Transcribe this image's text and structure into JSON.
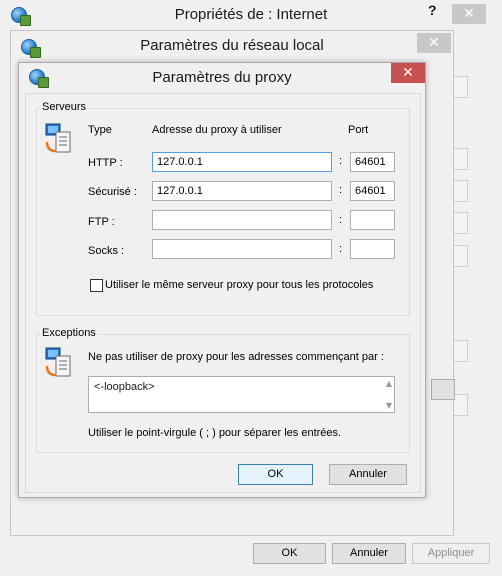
{
  "internet_props": {
    "title": "Propriétés de : Internet",
    "help_label": "?",
    "close_label": "✕",
    "ok_label": "OK",
    "cancel_label": "Annuler",
    "apply_label": "Appliquer"
  },
  "lan_settings": {
    "title": "Paramètres du réseau local",
    "close_label": "✕"
  },
  "proxy_settings": {
    "title": "Paramètres du proxy",
    "close_label": "✕",
    "servers": {
      "group_label": "Serveurs",
      "col_type": "Type",
      "col_address": "Adresse du proxy à utiliser",
      "col_port": "Port",
      "colon": ":",
      "rows": [
        {
          "type": "HTTP :",
          "address": "127.0.0.1",
          "port": "64601"
        },
        {
          "type": "Sécurisé :",
          "address": "127.0.0.1",
          "port": "64601"
        },
        {
          "type": "FTP :",
          "address": "",
          "port": ""
        },
        {
          "type": "Socks :",
          "address": "",
          "port": ""
        }
      ],
      "same_proxy_label": "Utiliser le même serveur proxy pour tous les protocoles",
      "same_proxy_checked": false
    },
    "exceptions": {
      "group_label": "Exceptions",
      "description": "Ne pas utiliser de proxy pour les adresses commençant par :",
      "value": "<-loopback>",
      "hint": "Utiliser le point-virgule ( ; ) pour séparer les entrées."
    },
    "ok_label": "OK",
    "cancel_label": "Annuler"
  },
  "colors": {
    "close_red": "#c75050",
    "dialog_bg": "#f0f0f0",
    "frame": "#c6c6c6"
  }
}
